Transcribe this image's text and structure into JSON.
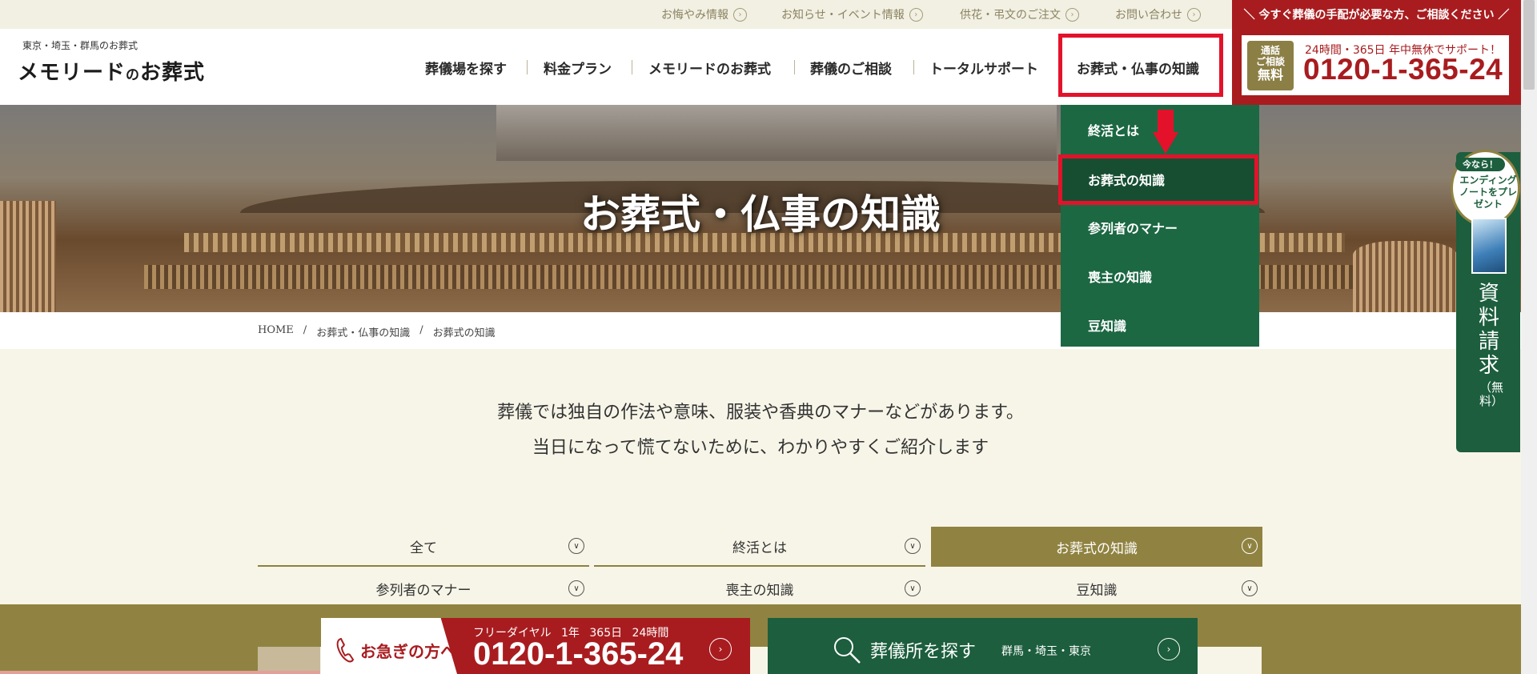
{
  "utility_links": [
    {
      "label": "お悔やみ情報"
    },
    {
      "label": "お知らせ・イベント情報"
    },
    {
      "label": "供花・弔文のご注文"
    },
    {
      "label": "お問い合わせ"
    }
  ],
  "logo": {
    "sub": "東京・埼玉・群馬のお葬式",
    "main_a": "メモリード",
    "main_b": "の",
    "main_c": "お葬式"
  },
  "nav": [
    {
      "label": "葬儀場を探す"
    },
    {
      "label": "料金プラン"
    },
    {
      "label": "メモリードのお葬式"
    },
    {
      "label": "葬儀のご相談"
    },
    {
      "label": "トータルサポート"
    },
    {
      "label": "お葬式・仏事の知識"
    }
  ],
  "contact": {
    "headline": "今すぐ葬儀の手配が必要な方、ご相談ください",
    "badge_line1": "通話",
    "badge_line2": "ご相談",
    "badge_line3": "無料",
    "sub": "24時間・365日 年中無休でサポート！",
    "tel": "0120-1-365-24"
  },
  "hero": {
    "title": "お葬式・仏事の知識"
  },
  "dropdown": [
    {
      "label": "終活とは"
    },
    {
      "label": "お葬式の知識"
    },
    {
      "label": "参列者のマナー"
    },
    {
      "label": "喪主の知識"
    },
    {
      "label": "豆知識"
    }
  ],
  "breadcrumb": [
    "HOME",
    "/",
    "お葬式・仏事の知識",
    "/",
    "お葬式の知識"
  ],
  "intro": {
    "line1": "葬儀では独自の作法や意味、服装や香典のマナーなどがあります。",
    "line2": "当日になって慌てないために、わかりやすくご紹介します"
  },
  "tabs": [
    {
      "label": "全て",
      "active": false
    },
    {
      "label": "終活とは",
      "active": false
    },
    {
      "label": "お葬式の知識",
      "active": true
    },
    {
      "label": "参列者のマナー",
      "active": false
    },
    {
      "label": "喪主の知識",
      "active": false
    },
    {
      "label": "豆知識",
      "active": false
    }
  ],
  "bottom": {
    "urgent_label": "お急ぎの方へ",
    "urgent_sub": "フリーダイヤル 1年 365日 24時間",
    "urgent_tel": "0120-1-365-24",
    "search_label": "葬儀所を探す",
    "search_sub": "群馬・埼玉・東京"
  },
  "side": {
    "now": "今なら！",
    "badge": "エンディングノートをプレゼント",
    "request": "資料請求",
    "free": "（無料）"
  },
  "colors": {
    "accent_red": "#a81c1f",
    "highlight_red": "#e3122a",
    "green": "#1c6843",
    "olive": "#908341",
    "background": "#f7f5e8"
  }
}
